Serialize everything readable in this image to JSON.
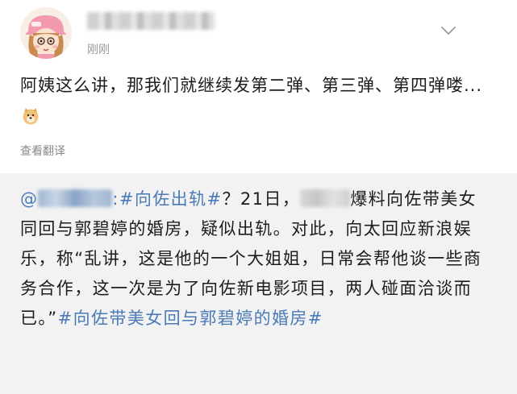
{
  "post": {
    "time": "刚刚",
    "text": "阿姨这么讲，那我们就继续发第二弹、第三弹、第四弹喽...",
    "translate": "查看翻译"
  },
  "repost": {
    "mention_prefix": "@",
    "mention_tail": ":",
    "topic1": "#向佐出轨#",
    "text_part1": "？21日，",
    "text_part2": "爆料向佐带美女同回与郭碧婷的婚房，疑似出轨。对此，向太回应新浪娱乐，称“乱讲，这是他的一个大姐姐，日常会帮他谈一些商务合作，这一次是为了向佐新电影项目，两人碰面洽谈而已。”",
    "topic2": "#向佐带美女回与郭碧婷的婚房#"
  },
  "icons": {
    "avatar": "avatar-girl-pink-cap",
    "more": "chevron-down-icon",
    "emoji": "doge-emoji-icon"
  },
  "colors": {
    "link": "#4a7ab7",
    "repost_bg": "#f2f2f2",
    "meta": "#9a9a9a"
  }
}
